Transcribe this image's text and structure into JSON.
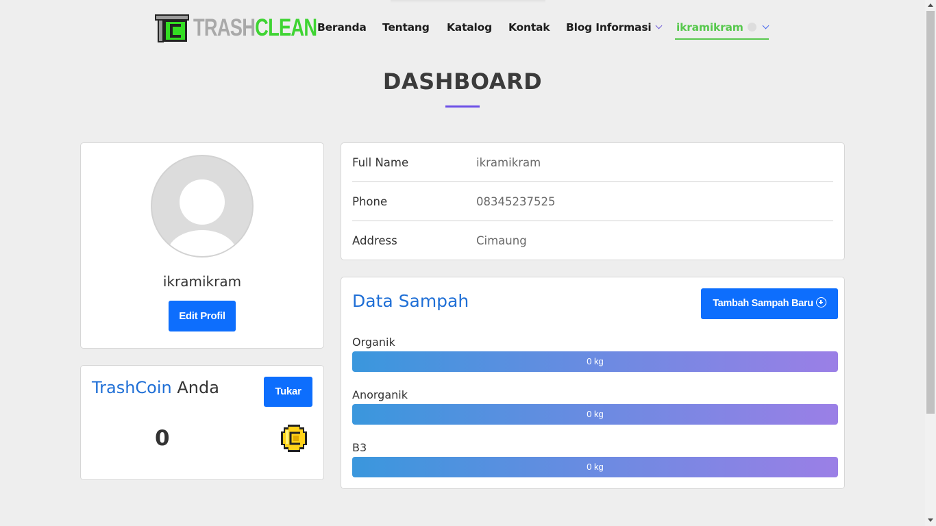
{
  "brand": {
    "part1": "TRASH",
    "part2": "CLEAN"
  },
  "nav": {
    "items": [
      "Beranda",
      "Tentang",
      "Katalog",
      "Kontak",
      "Blog Informasi"
    ],
    "user": "ikramikram"
  },
  "page": {
    "title": "DASHBOARD"
  },
  "profile": {
    "name": "ikramikram",
    "edit_label": "Edit Profil"
  },
  "coin": {
    "title_a": "TrashCoin",
    "title_b": "Anda",
    "exchange_label": "Tukar",
    "value": "0"
  },
  "info": [
    {
      "label": "Full Name",
      "value": "ikramikram"
    },
    {
      "label": "Phone",
      "value": "08345237525"
    },
    {
      "label": "Address",
      "value": "Cimaung"
    }
  ],
  "sampah": {
    "title": "Data Sampah",
    "add_label": "Tambah Sampah Baru",
    "categories": [
      {
        "label": "Organik",
        "value": "0 kg"
      },
      {
        "label": "Anorganik",
        "value": "0 kg"
      },
      {
        "label": "B3",
        "value": "0 kg"
      }
    ]
  },
  "colors": {
    "primary": "#0d6efd",
    "brand_green": "#3fd433",
    "accent_purple": "#6b4ee6",
    "link_blue": "#1f6fd6"
  }
}
